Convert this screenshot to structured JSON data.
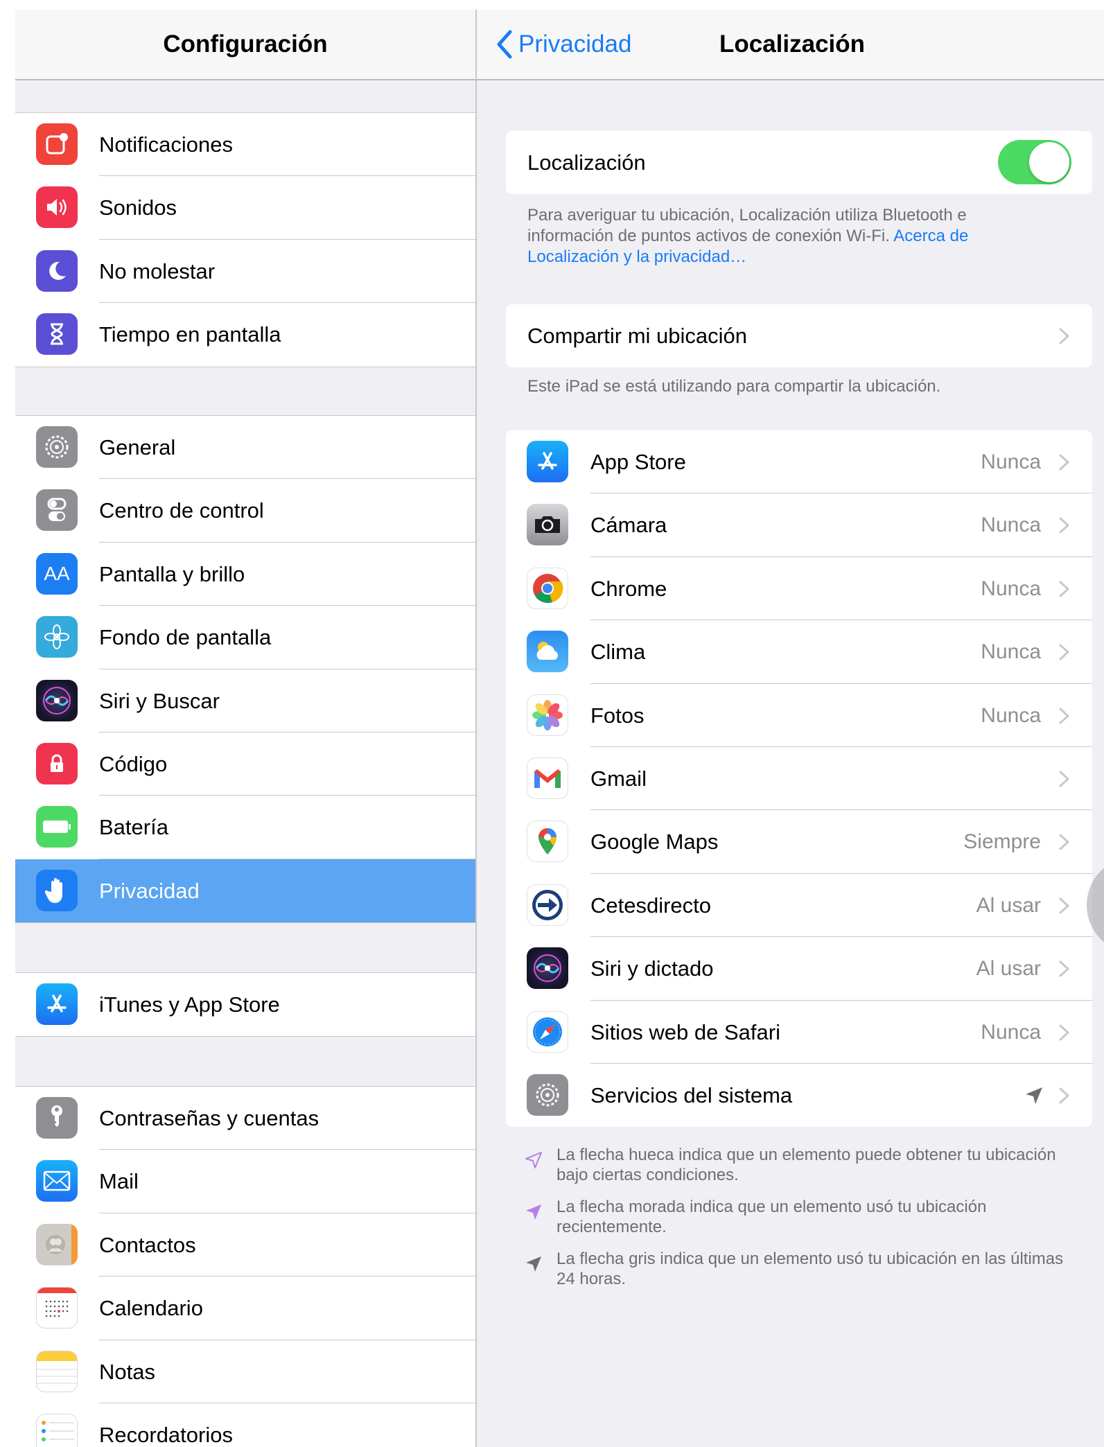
{
  "left": {
    "title": "Configuración",
    "groups": [
      [
        {
          "label": "Notificaciones",
          "icon": "notifications-icon",
          "color": "#f0433a"
        },
        {
          "label": "Sonidos",
          "icon": "sounds-icon",
          "color": "#f0334f"
        },
        {
          "label": "No molestar",
          "icon": "moon-icon",
          "color": "#5b4fd6"
        },
        {
          "label": "Tiempo en pantalla",
          "icon": "hourglass-icon",
          "color": "#5b4fd6"
        }
      ],
      [
        {
          "label": "General",
          "icon": "gear-icon",
          "color": "#8e8e93"
        },
        {
          "label": "Centro de control",
          "icon": "switches-icon",
          "color": "#8e8e93"
        },
        {
          "label": "Pantalla y brillo",
          "icon": "text-size-icon",
          "color": "#1c7ef2",
          "glyph": "AA"
        },
        {
          "label": "Fondo de pantalla",
          "icon": "flower-icon",
          "color": "#35aadc"
        },
        {
          "label": "Siri y Buscar",
          "icon": "siri-icon",
          "color": "#1d1d3a"
        },
        {
          "label": "Código",
          "icon": "lock-icon",
          "color": "#f0334f"
        },
        {
          "label": "Batería",
          "icon": "battery-icon",
          "color": "#4cd964"
        },
        {
          "label": "Privacidad",
          "icon": "hand-icon",
          "color": "#1c7ef2",
          "selected": true
        }
      ],
      [
        {
          "label": "iTunes y App Store",
          "icon": "app-store-icon",
          "color": "#1c8af2"
        }
      ],
      [
        {
          "label": "Contraseñas y cuentas",
          "icon": "key-icon",
          "color": "#8e8e93"
        },
        {
          "label": "Mail",
          "icon": "envelope-icon",
          "color": "#2b8ef0"
        },
        {
          "label": "Contactos",
          "icon": "contacts-icon",
          "color": "#c9c5c0"
        },
        {
          "label": "Calendario",
          "icon": "calendar-icon",
          "color": "#ffffff"
        },
        {
          "label": "Notas",
          "icon": "notes-icon",
          "color": "#ffffff"
        },
        {
          "label": "Recordatorios",
          "icon": "reminders-icon",
          "color": "#ffffff"
        }
      ]
    ]
  },
  "right": {
    "back_label": "Privacidad",
    "title": "Localización",
    "location_label": "Localización",
    "location_enabled": true,
    "location_footer_text": "Para averiguar tu ubicación, Localización utiliza Bluetooth e información de puntos activos de conexión Wi‑Fi. ",
    "location_footer_link": "Acerca de Localización y la privacidad…",
    "share_label": "Compartir mi ubicación",
    "share_footer": "Este iPad se está utilizando para compartir la ubicación.",
    "apps": [
      {
        "name": "App Store",
        "value": "Nunca",
        "icon": "app-store-icon"
      },
      {
        "name": "Cámara",
        "value": "Nunca",
        "icon": "camera-icon"
      },
      {
        "name": "Chrome",
        "value": "Nunca",
        "icon": "chrome-icon"
      },
      {
        "name": "Clima",
        "value": "Nunca",
        "icon": "weather-icon"
      },
      {
        "name": "Fotos",
        "value": "Nunca",
        "icon": "photos-icon"
      },
      {
        "name": "Gmail",
        "value": "",
        "icon": "gmail-icon"
      },
      {
        "name": "Google Maps",
        "value": "Siempre",
        "icon": "google-maps-icon"
      },
      {
        "name": "Cetesdirecto",
        "value": "Al usar",
        "icon": "cetesdirecto-icon"
      },
      {
        "name": "Siri y dictado",
        "value": "Al usar",
        "icon": "siri-icon"
      },
      {
        "name": "Sitios web de Safari",
        "value": "Nunca",
        "icon": "safari-icon"
      },
      {
        "name": "Servicios del sistema",
        "value": "",
        "icon": "gear-icon",
        "arrow": "location-arrow-gray-icon"
      }
    ],
    "legend": [
      {
        "text": "La flecha hueca indica que un elemento puede obtener tu ubicación bajo ciertas condiciones.",
        "icon": "hollow-arrow-icon",
        "color": "#b57ee8"
      },
      {
        "text": "La flecha morada indica que un elemento usó tu ubicación recientemente.",
        "icon": "purple-arrow-icon",
        "color": "#b57ee8"
      },
      {
        "text": "La flecha gris indica que un elemento usó tu ubicación en las últimas 24 horas.",
        "icon": "gray-arrow-icon",
        "color": "#8e8e93"
      }
    ]
  }
}
